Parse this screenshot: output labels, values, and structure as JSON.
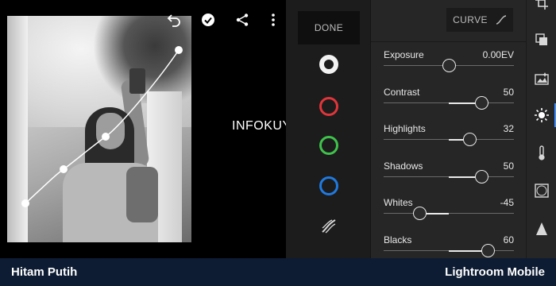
{
  "toolbar": {
    "undo_icon": "undo-icon",
    "confirm_icon": "check-circle-icon",
    "share_icon": "share-icon",
    "menu_icon": "more-vertical-icon"
  },
  "watermark": {
    "text": "INFOKUY.NET"
  },
  "channels": {
    "done_label": "DONE",
    "items": [
      {
        "name": "luminance",
        "color": "#f2f2f2",
        "selected": true
      },
      {
        "name": "red",
        "color": "#e0353a"
      },
      {
        "name": "green",
        "color": "#3fc24b"
      },
      {
        "name": "blue",
        "color": "#1f7ae0"
      },
      {
        "name": "split-tone",
        "icon": "split-tone-icon"
      }
    ]
  },
  "adjust": {
    "curve_label": "CURVE",
    "sliders": [
      {
        "label": "Exposure",
        "value": "0.00EV",
        "level": 0.5
      },
      {
        "label": "Contrast",
        "value": "50",
        "level": 0.75
      },
      {
        "label": "Highlights",
        "value": "32",
        "level": 0.66
      },
      {
        "label": "Shadows",
        "value": "50",
        "level": 0.75
      },
      {
        "label": "Whites",
        "value": "-45",
        "level": 0.275
      },
      {
        "label": "Blacks",
        "value": "60",
        "level": 0.8
      }
    ]
  },
  "toolstrip": {
    "items": [
      "crop-icon",
      "presets-icon",
      "auto-icon",
      "light-icon",
      "color-temperature-icon",
      "vignette-icon",
      "detail-icon"
    ],
    "active": "light-icon",
    "accent": "#3d8bff"
  },
  "caption": {
    "left": "Hitam Putih",
    "right": "Lightroom Mobile",
    "background": "#0d1c33"
  }
}
